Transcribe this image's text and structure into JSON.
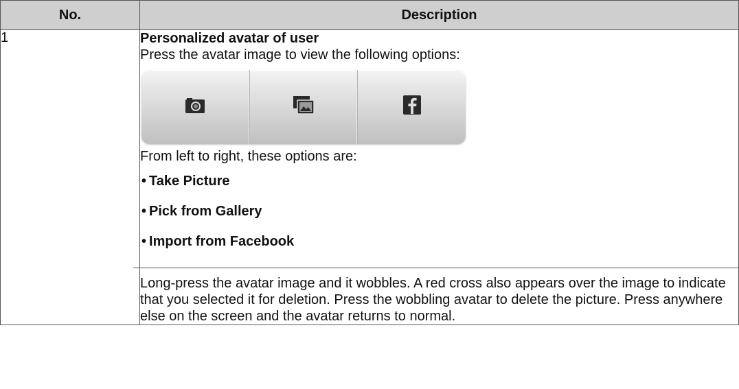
{
  "table": {
    "headers": {
      "no": "No.",
      "description": "Description"
    },
    "rows": [
      {
        "number": "1",
        "title": "Personalized avatar of user",
        "intro": "Press the avatar image to view the following options:",
        "option_icons": [
          "camera-icon",
          "gallery-icon",
          "facebook-icon"
        ],
        "options_lead": "From left to right, these options are:",
        "options": [
          "Take Picture",
          "Pick from Gallery",
          "Import from Facebook"
        ],
        "note": "Long-press the avatar image and it wobbles. A red cross also appears over the image to indicate that you selected it for deletion. Press the wobbling avatar to delete the picture. Press anywhere else on the screen and the avatar returns to normal."
      }
    ]
  },
  "colors": {
    "header_bg": "#cfcfcf",
    "border": "#555555",
    "icon": "#222222"
  }
}
